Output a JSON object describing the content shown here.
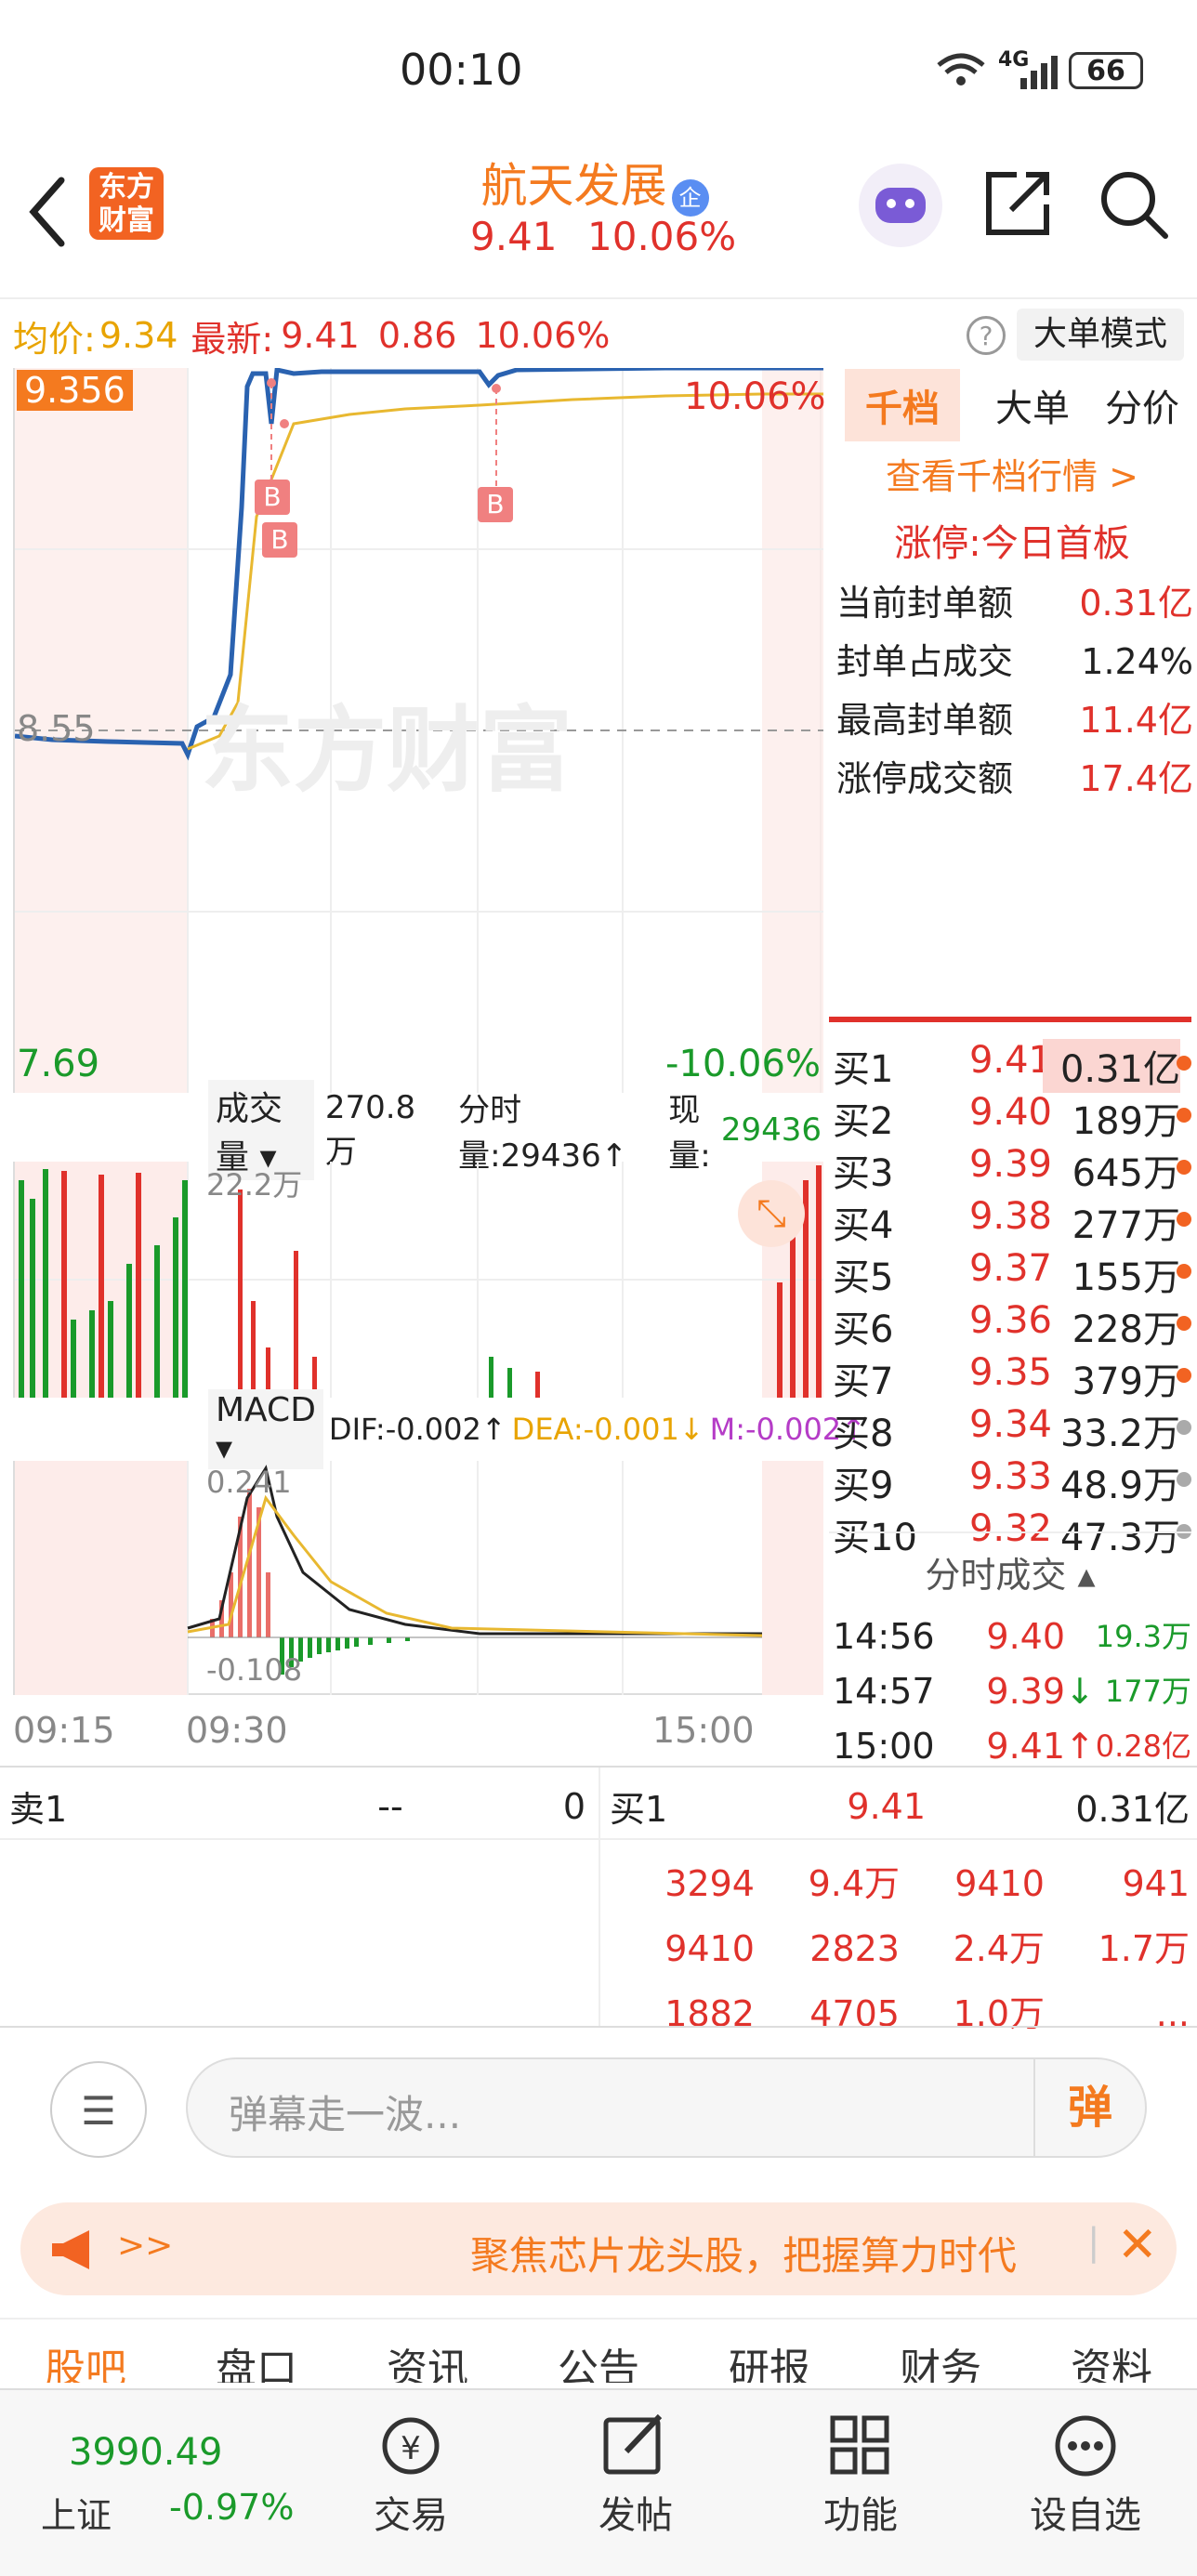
{
  "status_bar": {
    "time": "00:10",
    "signal": "4G",
    "battery": "66"
  },
  "header": {
    "logo": "东方财富",
    "stock_name": "航天发展",
    "badge": "企",
    "price": "9.41",
    "change_pct": "10.06%"
  },
  "infobar": {
    "avg_label": "均价:",
    "avg_value": "9.34",
    "latest_label": "最新:",
    "latest_value": "9.41",
    "change": "0.86",
    "change_pct": "10.06%",
    "mode_button": "大单模式"
  },
  "price_chart": {
    "y_top": "9.356",
    "y_mid": "8.55",
    "y_bottom": "7.69",
    "pct_top": "10.06%",
    "pct_bottom": "-10.06%",
    "watermark": "东方财富",
    "buy_marks": [
      "B",
      "B",
      "B"
    ],
    "time_start": "09:15",
    "time_open": "09:30",
    "time_end": "15:00"
  },
  "volume_chart": {
    "indicator": "成交量",
    "total": "270.8万",
    "time_volume": "分时量:29436",
    "current_label": "现量:",
    "current_value": "29436",
    "max_label": "22.2万"
  },
  "macd_chart": {
    "indicator": "MACD",
    "dif": "DIF:-0.002",
    "dea": "DEA:-0.001",
    "m": "M:-0.002",
    "y_top": "0.241",
    "y_bottom": "-0.108"
  },
  "sidebar": {
    "tabs": [
      "千档",
      "大单",
      "分价"
    ],
    "link": "查看千档行情 >",
    "limit_title": "涨停:今日首板",
    "stats": [
      {
        "label": "当前封单额",
        "value": "0.31亿"
      },
      {
        "label": "封单占成交",
        "value": "1.24%"
      },
      {
        "label": "最高封单额",
        "value": "11.4亿"
      },
      {
        "label": "涨停成交额",
        "value": "17.4亿"
      }
    ]
  },
  "order_book": [
    {
      "label": "买1",
      "price": "9.41",
      "vol": "0.31亿"
    },
    {
      "label": "买2",
      "price": "9.40",
      "vol": "189万"
    },
    {
      "label": "买3",
      "price": "9.39",
      "vol": "645万"
    },
    {
      "label": "买4",
      "price": "9.38",
      "vol": "277万"
    },
    {
      "label": "买5",
      "price": "9.37",
      "vol": "155万"
    },
    {
      "label": "买6",
      "price": "9.36",
      "vol": "228万"
    },
    {
      "label": "买7",
      "price": "9.35",
      "vol": "379万"
    },
    {
      "label": "买8",
      "price": "9.34",
      "vol": "33.2万"
    },
    {
      "label": "买9",
      "price": "9.33",
      "vol": "48.9万"
    },
    {
      "label": "买10",
      "price": "9.32",
      "vol": "47.3万"
    }
  ],
  "ticks": {
    "title": "分时成交",
    "rows": [
      {
        "time": "14:56",
        "price": "9.40",
        "vol": "19.3万",
        "arrow": ""
      },
      {
        "time": "14:57",
        "price": "9.39",
        "vol": "177万",
        "arrow": "↓"
      },
      {
        "time": "15:00",
        "price": "9.41",
        "vol": "0.28亿",
        "arrow": "↑"
      }
    ]
  },
  "queue": {
    "sell_label": "卖1",
    "sell_price": "--",
    "sell_vol": "0",
    "buy_label": "买1",
    "buy_price": "9.41",
    "buy_vol": "0.31亿",
    "rows": [
      [
        "3294",
        "9.4万",
        "9410",
        "941"
      ],
      [
        "9410",
        "2823",
        "2.4万",
        "1.7万"
      ],
      [
        "1882",
        "4705",
        "1.0万",
        "..."
      ]
    ]
  },
  "comment": {
    "placeholder": "弹幕走一波...",
    "danmu_label": "弹"
  },
  "banner": {
    "arrows": ">>",
    "text": "聚焦芯片龙头股，把握算力时代"
  },
  "tabs": [
    "股吧",
    "盘口",
    "资讯",
    "公告",
    "研报",
    "财务",
    "资料"
  ],
  "bottom_nav": {
    "index_value": "3990.49",
    "index_name": "上证",
    "index_change": "-0.97%",
    "items": [
      "交易",
      "发帖",
      "功能",
      "设自选"
    ]
  },
  "colors": {
    "up": "#e0312b",
    "down": "#1a9a2a",
    "accent": "#f47a1f",
    "price_line": "#2a62b0",
    "avg_line": "#e8b830"
  }
}
